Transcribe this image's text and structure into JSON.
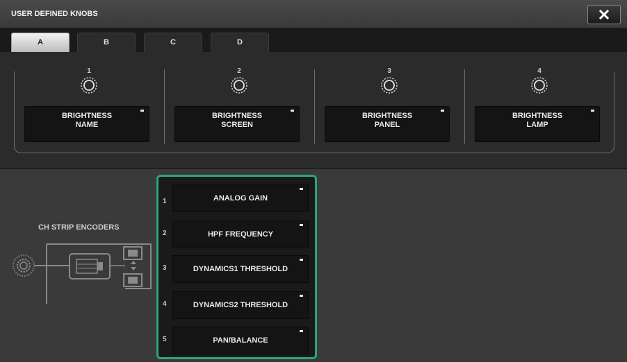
{
  "window": {
    "title": "USER DEFINED KNOBS"
  },
  "tabs": [
    {
      "label": "A",
      "active": true
    },
    {
      "label": "B",
      "active": false
    },
    {
      "label": "C",
      "active": false
    },
    {
      "label": "D",
      "active": false
    }
  ],
  "knobs": [
    {
      "number": "1",
      "line1": "BRIGHTNESS",
      "line2": "NAME"
    },
    {
      "number": "2",
      "line1": "BRIGHTNESS",
      "line2": "SCREEN"
    },
    {
      "number": "3",
      "line1": "BRIGHTNESS",
      "line2": "PANEL"
    },
    {
      "number": "4",
      "line1": "BRIGHTNESS",
      "line2": "LAMP"
    }
  ],
  "ch_strip": {
    "title": "CH STRIP ENCODERS",
    "encoders": [
      {
        "number": "1",
        "label": "ANALOG GAIN"
      },
      {
        "number": "2",
        "label": "HPF FREQUENCY"
      },
      {
        "number": "3",
        "label": "DYNAMICS1 THRESHOLD"
      },
      {
        "number": "4",
        "label": "DYNAMICS2 THRESHOLD"
      },
      {
        "number": "5",
        "label": "PAN/BALANCE"
      }
    ]
  },
  "colors": {
    "highlight": "#2ba77d",
    "active_tab": "#e8e8e8"
  },
  "icons": [
    "close-icon",
    "knob-icon",
    "popup-indicator-icon",
    "encoder-ring-icon",
    "strip-panel-icon"
  ]
}
